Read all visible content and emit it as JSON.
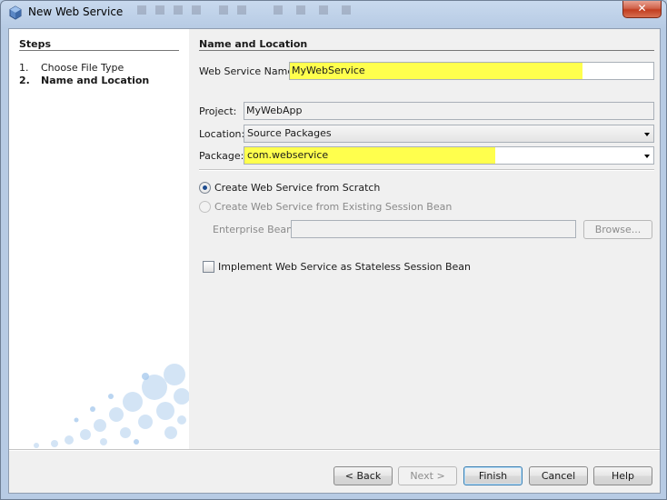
{
  "window": {
    "title": "New Web Service",
    "close_label": "✕"
  },
  "steps": {
    "title": "Steps",
    "items": [
      {
        "number": "1.",
        "label": "Choose File Type"
      },
      {
        "number": "2.",
        "label": "Name and Location"
      }
    ]
  },
  "form": {
    "section_title": "Name and Location",
    "web_service_name": {
      "label": "Web Service Name:",
      "value": "MyWebService"
    },
    "project": {
      "label": "Project:",
      "value": "MyWebApp"
    },
    "location": {
      "label": "Location:",
      "value": "Source Packages"
    },
    "package": {
      "label": "Package:",
      "value": "com.webservice"
    },
    "create_from_scratch": {
      "label": "Create Web Service from Scratch",
      "selected": true
    },
    "create_from_bean": {
      "label": "Create Web Service from Existing Session Bean",
      "selected": false
    },
    "enterprise_bean": {
      "label": "Enterprise Bean:",
      "value": ""
    },
    "browse_label": "Browse...",
    "stateless_checkbox": {
      "label": "Implement Web Service as Stateless Session Bean",
      "checked": false
    }
  },
  "buttons": {
    "back": "< Back",
    "next": "Next >",
    "finish": "Finish",
    "cancel": "Cancel",
    "help": "Help"
  },
  "colors": {
    "highlight": "#ffff4d",
    "window_frame": "#b7cbe4",
    "close_button": "#c23e21"
  }
}
